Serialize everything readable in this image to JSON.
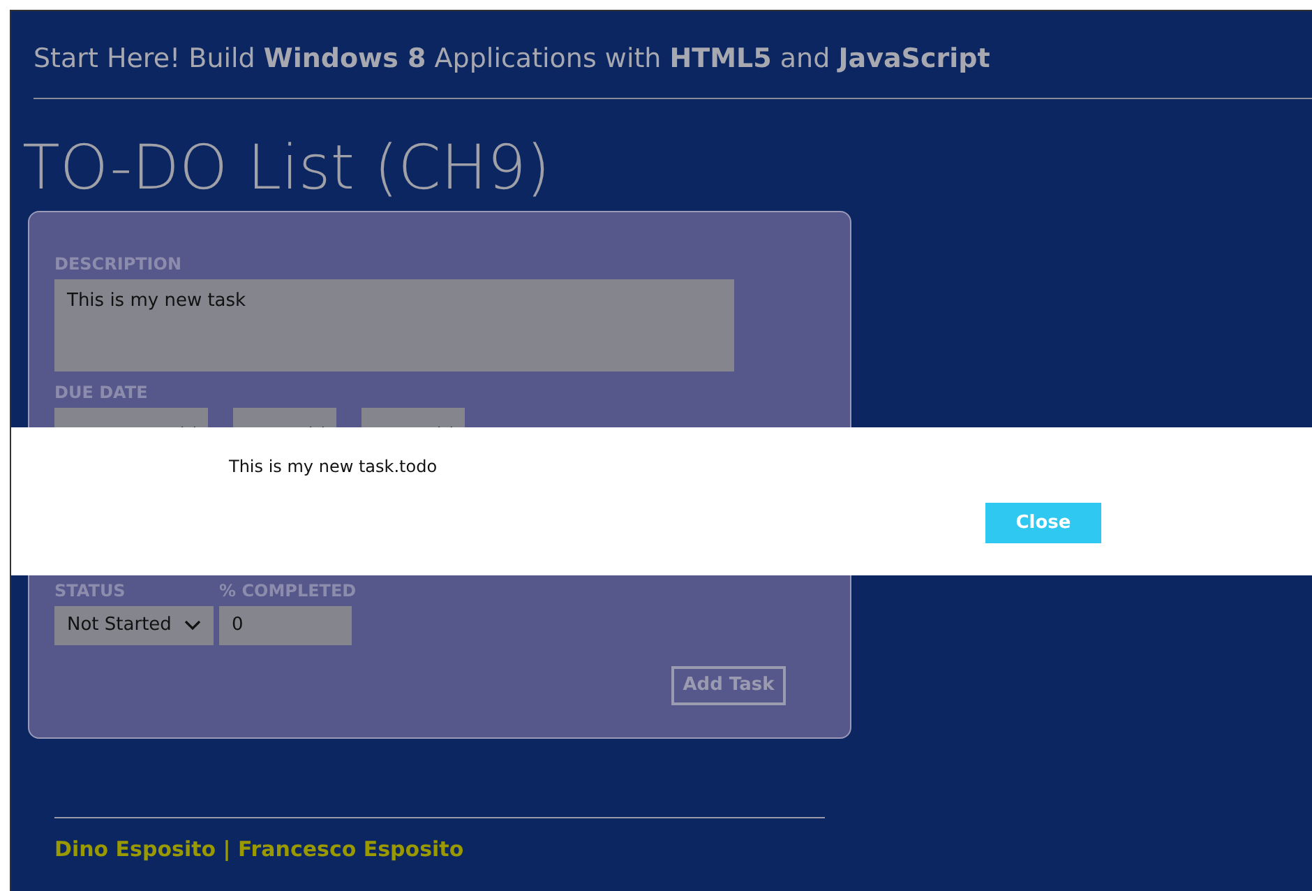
{
  "header": {
    "text": "Start Here! Build **Windows 8** Applications with **HTML5** and **JavaScript**"
  },
  "title": "TO-DO List (CH9)",
  "form": {
    "description": {
      "label": "DESCRIPTION",
      "value": "This is my new task"
    },
    "due_date": {
      "label": "DUE DATE"
    },
    "status": {
      "label": "STATUS",
      "value": "Not Started"
    },
    "completed": {
      "label": "% COMPLETED",
      "value": "0"
    },
    "add_button": "Add Task"
  },
  "footer": "Dino Esposito | Francesco Esposito",
  "dialog": {
    "message": "This is my new task.todo",
    "button": "Close"
  }
}
